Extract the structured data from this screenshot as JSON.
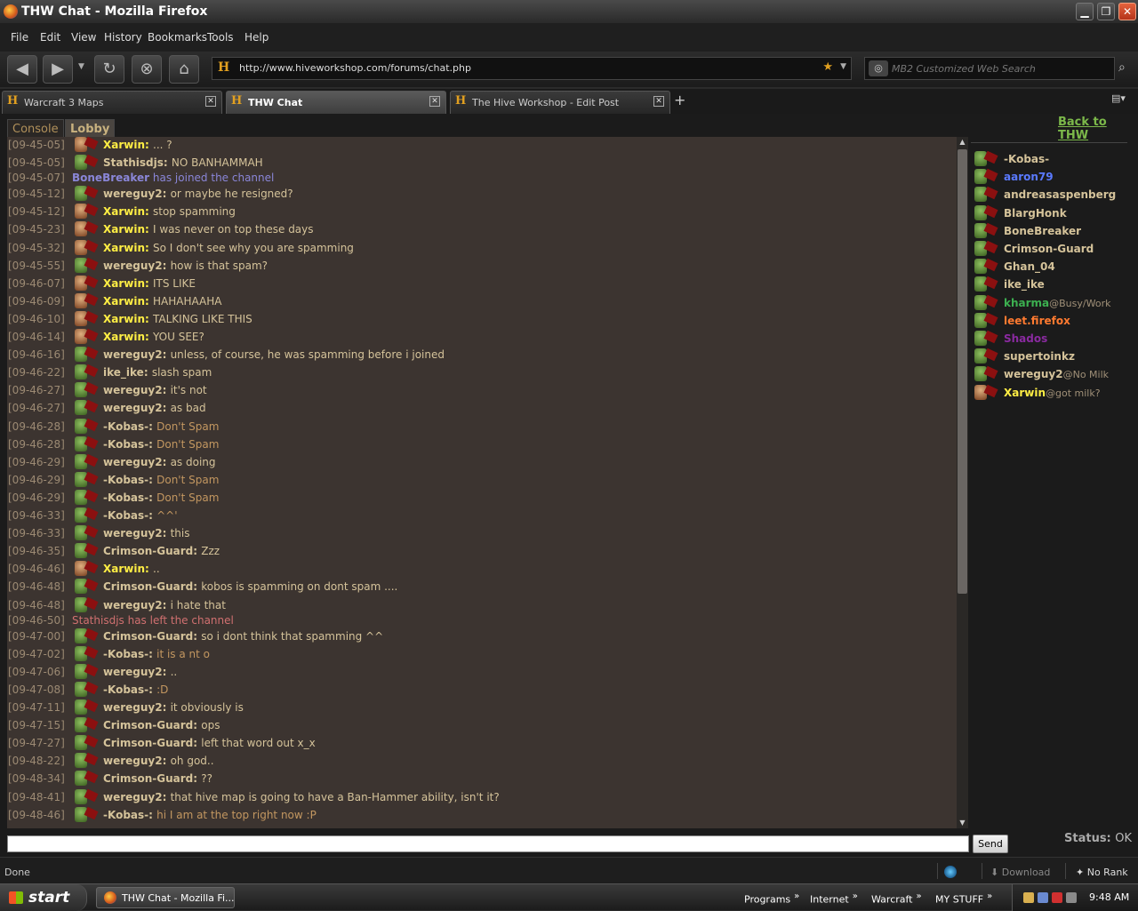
{
  "window": {
    "title": "THW Chat - Mozilla Firefox"
  },
  "menu": [
    "File",
    "Edit",
    "View",
    "History",
    "Bookmarks",
    "Tools",
    "Help"
  ],
  "nav": {
    "url": "http://www.hiveworkshop.com/forums/chat.php",
    "search_placeholder": "MB2 Customized Web Search"
  },
  "tabs": [
    {
      "label": "Warcraft 3 Maps",
      "active": false
    },
    {
      "label": "THW Chat",
      "active": true
    },
    {
      "label": "The Hive Workshop - Edit Post",
      "active": false
    }
  ],
  "chat": {
    "tabs": {
      "console": "Console",
      "lobby": "Lobby"
    },
    "back_link": "Back to THW",
    "send_label": "Send",
    "status_label": "Status:",
    "status_value": "OK",
    "messages": [
      {
        "type": "msg",
        "ts": "[09-45-05]",
        "nick": "Xarwin:",
        "text": "... ?",
        "av": "human",
        "nc": "#ffee44",
        "mc": "#d5c39a"
      },
      {
        "type": "msg",
        "ts": "[09-45-05]",
        "nick": "Stathisdjs:",
        "text": "NO BANHAMMAH",
        "av": "orc",
        "nc": "#d5c39a",
        "mc": "#d5c39a"
      },
      {
        "type": "sys",
        "ts": "[09-45-07]",
        "text": "BoneBreaker has joined the channel",
        "sc": "#8a86d8",
        "bold_prefix": "BoneBreaker"
      },
      {
        "type": "msg",
        "ts": "[09-45-12]",
        "nick": "wereguy2:",
        "text": "or maybe he resigned?",
        "av": "orc",
        "nc": "#d5c39a",
        "mc": "#d5c39a"
      },
      {
        "type": "msg",
        "ts": "[09-45-12]",
        "nick": "Xarwin:",
        "text": "stop spamming",
        "av": "human",
        "nc": "#ffee44",
        "mc": "#d5c39a"
      },
      {
        "type": "msg",
        "ts": "[09-45-23]",
        "nick": "Xarwin:",
        "text": "I was never on top these days",
        "av": "human",
        "nc": "#ffee44",
        "mc": "#d5c39a"
      },
      {
        "type": "msg",
        "ts": "[09-45-32]",
        "nick": "Xarwin:",
        "text": "So I don't see why you are spamming",
        "av": "human",
        "nc": "#ffee44",
        "mc": "#d5c39a"
      },
      {
        "type": "msg",
        "ts": "[09-45-55]",
        "nick": "wereguy2:",
        "text": "how is that spam?",
        "av": "orc",
        "nc": "#d5c39a",
        "mc": "#d5c39a"
      },
      {
        "type": "msg",
        "ts": "[09-46-07]",
        "nick": "Xarwin:",
        "text": "ITS LIKE",
        "av": "human",
        "nc": "#ffee44",
        "mc": "#d5c39a"
      },
      {
        "type": "msg",
        "ts": "[09-46-09]",
        "nick": "Xarwin:",
        "text": "HAHAHAAHA",
        "av": "human",
        "nc": "#ffee44",
        "mc": "#d5c39a"
      },
      {
        "type": "msg",
        "ts": "[09-46-10]",
        "nick": "Xarwin:",
        "text": "TALKING LIKE THIS",
        "av": "human",
        "nc": "#ffee44",
        "mc": "#d5c39a"
      },
      {
        "type": "msg",
        "ts": "[09-46-14]",
        "nick": "Xarwin:",
        "text": "YOU SEE?",
        "av": "human",
        "nc": "#ffee44",
        "mc": "#d5c39a"
      },
      {
        "type": "msg",
        "ts": "[09-46-16]",
        "nick": "wereguy2:",
        "text": "unless, of course, he was spamming before i joined",
        "av": "orc",
        "nc": "#d5c39a",
        "mc": "#d5c39a"
      },
      {
        "type": "msg",
        "ts": "[09-46-22]",
        "nick": "ike_ike:",
        "text": "slash spam",
        "av": "orc",
        "nc": "#d5c39a",
        "mc": "#d5c39a"
      },
      {
        "type": "msg",
        "ts": "[09-46-27]",
        "nick": "wereguy2:",
        "text": "it's not",
        "av": "orc",
        "nc": "#d5c39a",
        "mc": "#d5c39a"
      },
      {
        "type": "msg",
        "ts": "[09-46-27]",
        "nick": "wereguy2:",
        "text": "as bad",
        "av": "orc",
        "nc": "#d5c39a",
        "mc": "#d5c39a"
      },
      {
        "type": "msg",
        "ts": "[09-46-28]",
        "nick": "-Kobas-:",
        "text": "Don't Spam",
        "av": "orc",
        "nc": "#d5c39a",
        "mc": "#c39760"
      },
      {
        "type": "msg",
        "ts": "[09-46-28]",
        "nick": "-Kobas-:",
        "text": "Don't Spam",
        "av": "orc",
        "nc": "#d5c39a",
        "mc": "#c39760"
      },
      {
        "type": "msg",
        "ts": "[09-46-29]",
        "nick": "wereguy2:",
        "text": "as doing",
        "av": "orc",
        "nc": "#d5c39a",
        "mc": "#d5c39a"
      },
      {
        "type": "msg",
        "ts": "[09-46-29]",
        "nick": "-Kobas-:",
        "text": "Don't Spam",
        "av": "orc",
        "nc": "#d5c39a",
        "mc": "#c39760"
      },
      {
        "type": "msg",
        "ts": "[09-46-29]",
        "nick": "-Kobas-:",
        "text": "Don't Spam",
        "av": "orc",
        "nc": "#d5c39a",
        "mc": "#c39760"
      },
      {
        "type": "msg",
        "ts": "[09-46-33]",
        "nick": "-Kobas-:",
        "text": "^^'",
        "av": "orc",
        "nc": "#d5c39a",
        "mc": "#c39760"
      },
      {
        "type": "msg",
        "ts": "[09-46-33]",
        "nick": "wereguy2:",
        "text": "this",
        "av": "orc",
        "nc": "#d5c39a",
        "mc": "#d5c39a"
      },
      {
        "type": "msg",
        "ts": "[09-46-35]",
        "nick": "Crimson-Guard:",
        "text": "Zzz",
        "av": "orc",
        "nc": "#d5c39a",
        "mc": "#d5c39a"
      },
      {
        "type": "msg",
        "ts": "[09-46-46]",
        "nick": "Xarwin:",
        "text": "..",
        "av": "human",
        "nc": "#ffee44",
        "mc": "#d5c39a"
      },
      {
        "type": "msg",
        "ts": "[09-46-48]",
        "nick": "Crimson-Guard:",
        "text": "kobos is spamming on dont spam ....",
        "av": "orc",
        "nc": "#d5c39a",
        "mc": "#d5c39a"
      },
      {
        "type": "msg",
        "ts": "[09-46-48]",
        "nick": "wereguy2:",
        "text": "i hate that",
        "av": "orc",
        "nc": "#d5c39a",
        "mc": "#d5c39a"
      },
      {
        "type": "sys",
        "ts": "[09-46-50]",
        "text": "Stathisdjs has left the channel",
        "sc": "#d07070",
        "bold_prefix": ""
      },
      {
        "type": "msg",
        "ts": "[09-47-00]",
        "nick": "Crimson-Guard:",
        "text": "so i dont think that spamming ^^",
        "av": "orc",
        "nc": "#d5c39a",
        "mc": "#d5c39a"
      },
      {
        "type": "msg",
        "ts": "[09-47-02]",
        "nick": "-Kobas-:",
        "text": "it is a nt o",
        "av": "orc",
        "nc": "#d5c39a",
        "mc": "#c39760"
      },
      {
        "type": "msg",
        "ts": "[09-47-06]",
        "nick": "wereguy2:",
        "text": "..",
        "av": "orc",
        "nc": "#d5c39a",
        "mc": "#d5c39a"
      },
      {
        "type": "msg",
        "ts": "[09-47-08]",
        "nick": "-Kobas-:",
        "text": ":D",
        "av": "orc",
        "nc": "#d5c39a",
        "mc": "#c39760"
      },
      {
        "type": "msg",
        "ts": "[09-47-11]",
        "nick": "wereguy2:",
        "text": "it obviously is",
        "av": "orc",
        "nc": "#d5c39a",
        "mc": "#d5c39a"
      },
      {
        "type": "msg",
        "ts": "[09-47-15]",
        "nick": "Crimson-Guard:",
        "text": "ops",
        "av": "orc",
        "nc": "#d5c39a",
        "mc": "#d5c39a"
      },
      {
        "type": "msg",
        "ts": "[09-47-27]",
        "nick": "Crimson-Guard:",
        "text": "left that word out x_x",
        "av": "orc",
        "nc": "#d5c39a",
        "mc": "#d5c39a"
      },
      {
        "type": "msg",
        "ts": "[09-48-22]",
        "nick": "wereguy2:",
        "text": "oh god..",
        "av": "orc",
        "nc": "#d5c39a",
        "mc": "#d5c39a"
      },
      {
        "type": "msg",
        "ts": "[09-48-34]",
        "nick": "Crimson-Guard:",
        "text": "??",
        "av": "orc",
        "nc": "#d5c39a",
        "mc": "#d5c39a"
      },
      {
        "type": "msg",
        "ts": "[09-48-41]",
        "nick": "wereguy2:",
        "text": "that hive map is going to have a Ban-Hammer ability, isn't it?",
        "av": "orc",
        "nc": "#d5c39a",
        "mc": "#d5c39a"
      },
      {
        "type": "msg",
        "ts": "[09-48-46]",
        "nick": "-Kobas-:",
        "text": "hi I am at the top right now :P",
        "av": "orc",
        "nc": "#d5c39a",
        "mc": "#c39760"
      }
    ]
  },
  "users": [
    {
      "name": "-Kobas-",
      "status": "",
      "color": "#d5c39a",
      "av": "orc"
    },
    {
      "name": "aaron79",
      "status": "",
      "color": "#5a7aff",
      "av": "orc"
    },
    {
      "name": "andreasaspenberg",
      "status": "",
      "color": "#d5c39a",
      "av": "orc"
    },
    {
      "name": "BlargHonk",
      "status": "",
      "color": "#d5c39a",
      "av": "orc"
    },
    {
      "name": "BoneBreaker",
      "status": "",
      "color": "#d5c39a",
      "av": "orc"
    },
    {
      "name": "Crimson-Guard",
      "status": "",
      "color": "#d5c39a",
      "av": "orc"
    },
    {
      "name": "Ghan_04",
      "status": "",
      "color": "#d5c39a",
      "av": "orc"
    },
    {
      "name": "ike_ike",
      "status": "",
      "color": "#d5c39a",
      "av": "orc"
    },
    {
      "name": "kharma",
      "status": "@Busy/Work",
      "color": "#3cb050",
      "av": "orc"
    },
    {
      "name": "leet.firefox",
      "status": "",
      "color": "#ff7a30",
      "av": "orc"
    },
    {
      "name": "Shados",
      "status": "",
      "color": "#8a2aa0",
      "av": "orc"
    },
    {
      "name": "supertoinkz",
      "status": "",
      "color": "#d5c39a",
      "av": "orc"
    },
    {
      "name": "wereguy2",
      "status": "@No Milk",
      "color": "#d5c39a",
      "av": "orc"
    },
    {
      "name": "Xarwin",
      "status": "@got milk?",
      "color": "#ffee44",
      "av": "human"
    }
  ],
  "statusbar": {
    "done": "Done",
    "download": "Download",
    "rank": "No Rank"
  },
  "taskbar": {
    "start": "start",
    "task": "THW Chat - Mozilla Fi...",
    "quick": [
      "Programs",
      "Internet",
      "Warcraft",
      "MY STUFF"
    ],
    "clock": "9:48 AM"
  },
  "colors": {
    "nick_default": "#d5c39a",
    "nick_xarwin": "#ffee44",
    "msg_kobas": "#c39760",
    "join": "#8a86d8",
    "leave": "#d07070",
    "back_link": "#7cb94a"
  }
}
